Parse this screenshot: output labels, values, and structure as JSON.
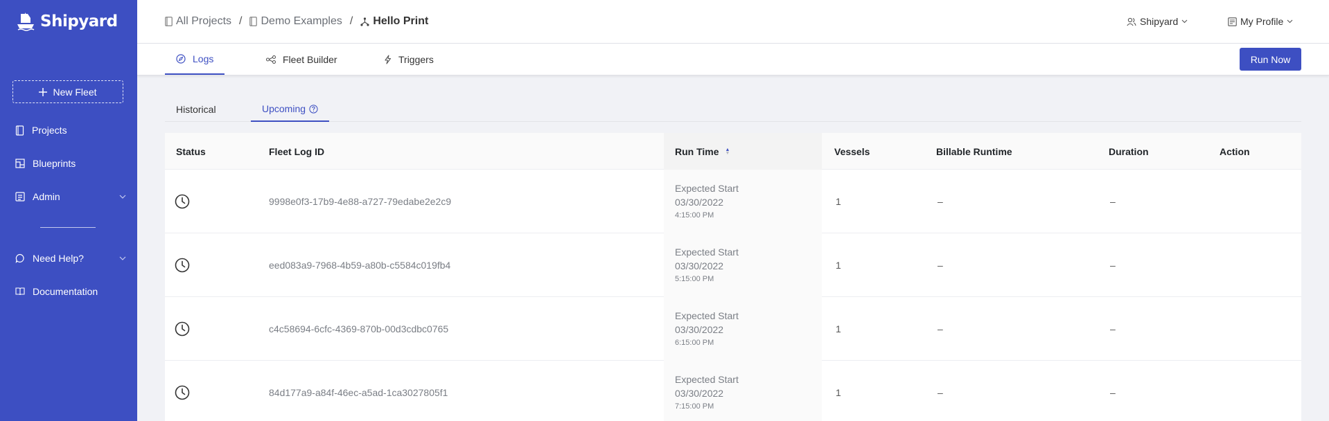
{
  "brand": {
    "name": "Shipyard"
  },
  "sidebar": {
    "new_fleet": "New Fleet",
    "items": [
      {
        "label": "Projects",
        "icon": "book-icon"
      },
      {
        "label": "Blueprints",
        "icon": "blueprint-icon"
      },
      {
        "label": "Admin",
        "icon": "admin-icon"
      }
    ],
    "help_items": [
      {
        "label": "Need Help?",
        "icon": "chat-icon"
      },
      {
        "label": "Documentation",
        "icon": "book-open-icon"
      }
    ]
  },
  "header": {
    "breadcrumb": [
      "All Projects",
      "Demo Examples",
      "Hello Print"
    ],
    "org_menu": "Shipyard",
    "profile_menu": "My Profile"
  },
  "tabs": {
    "items": [
      "Logs",
      "Fleet Builder",
      "Triggers"
    ],
    "active": "Logs",
    "run_now": "Run Now"
  },
  "subtabs": {
    "items": [
      "Historical",
      "Upcoming"
    ],
    "active": "Upcoming"
  },
  "table": {
    "columns": [
      "Status",
      "Fleet Log ID",
      "Run Time",
      "Vessels",
      "Billable Runtime",
      "Duration",
      "Action"
    ],
    "sorted_column": "Run Time",
    "sort_direction": "ascending",
    "rows": [
      {
        "status_icon": "clock-icon",
        "id": "9998e0f3-17b9-4e88-a727-79edabe2e2c9",
        "run_label": "Expected Start",
        "run_date": "03/30/2022",
        "run_time": "4:15:00 PM",
        "vessels": "1",
        "billable": "–",
        "duration": "–"
      },
      {
        "status_icon": "clock-icon",
        "id": "eed083a9-7968-4b59-a80b-c5584c019fb4",
        "run_label": "Expected Start",
        "run_date": "03/30/2022",
        "run_time": "5:15:00 PM",
        "vessels": "1",
        "billable": "–",
        "duration": "–"
      },
      {
        "status_icon": "clock-icon",
        "id": "c4c58694-6cfc-4369-870b-00d3cdbc0765",
        "run_label": "Expected Start",
        "run_date": "03/30/2022",
        "run_time": "6:15:00 PM",
        "vessels": "1",
        "billable": "–",
        "duration": "–"
      },
      {
        "status_icon": "clock-icon",
        "id": "84d177a9-a84f-46ec-a5ad-1ca3027805f1",
        "run_label": "Expected Start",
        "run_date": "03/30/2022",
        "run_time": "7:15:00 PM",
        "vessels": "1",
        "billable": "–",
        "duration": "–"
      }
    ]
  },
  "colors": {
    "brand": "#3d4fc2",
    "page_bg": "#f1f2f6"
  }
}
